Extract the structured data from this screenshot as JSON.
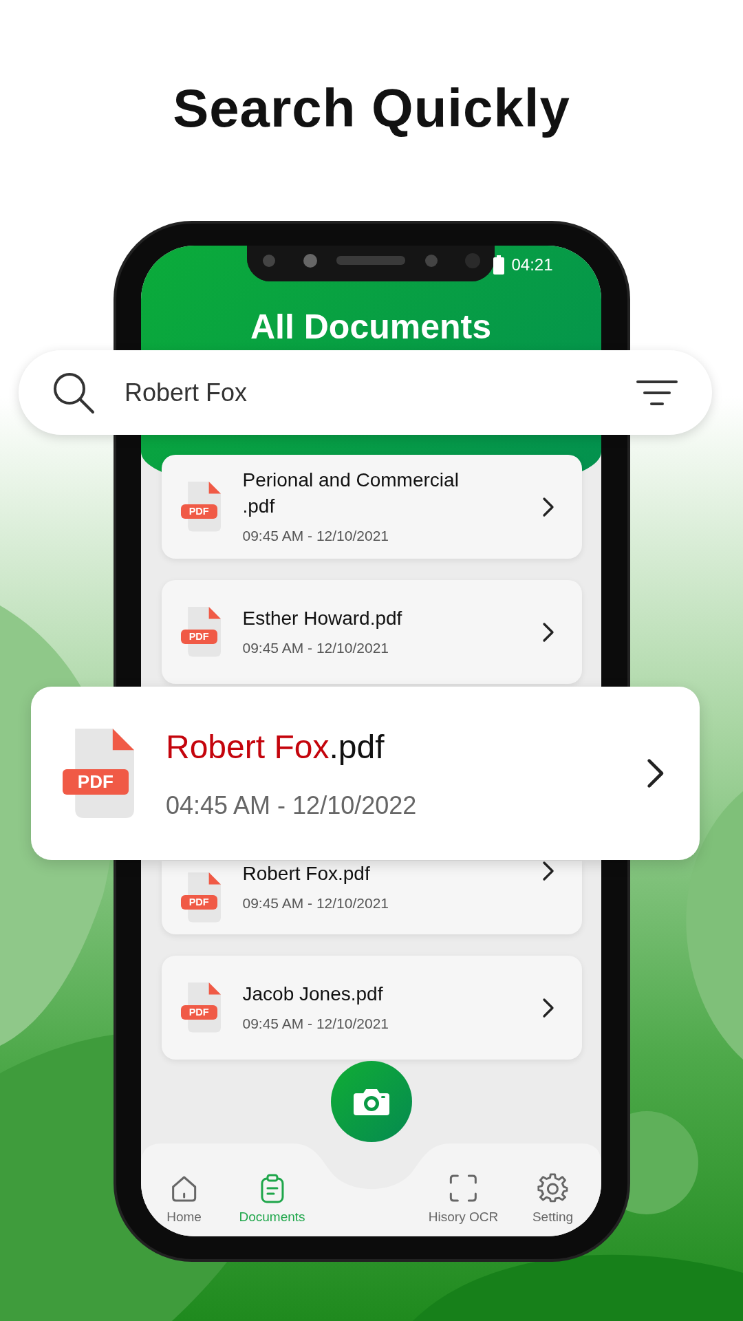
{
  "headline": "Search Quickly",
  "status_bar": {
    "time": "04:21"
  },
  "screen_title": "All Documents",
  "search": {
    "value": "Robert Fox"
  },
  "documents": [
    {
      "name": "Perional and Commercial .pdf",
      "file_type": "PDF",
      "timestamp": "09:45 AM - 12/10/2021",
      "covered": false
    },
    {
      "name": "Esther Howard.pdf",
      "file_type": "PDF",
      "timestamp": "09:45 AM - 12/10/2021",
      "covered": false
    },
    {
      "name": "Robert Fox.pdf",
      "file_type": "PDF",
      "timestamp": "09:45 AM - 12/10/2021",
      "covered": true
    },
    {
      "name": "Jacob Jones.pdf",
      "file_type": "PDF",
      "timestamp": "09:45 AM - 12/10/2021",
      "covered": false
    }
  ],
  "search_result": {
    "match": "Robert Fox",
    "rest": ".pdf",
    "file_type": "PDF",
    "timestamp": "04:45 AM - 12/10/2022"
  },
  "nav": [
    {
      "label": "Home",
      "selected": false
    },
    {
      "label": "Documents",
      "selected": true
    },
    {
      "label": "Hisory OCR",
      "selected": false
    },
    {
      "label": "Setting",
      "selected": false
    }
  ]
}
